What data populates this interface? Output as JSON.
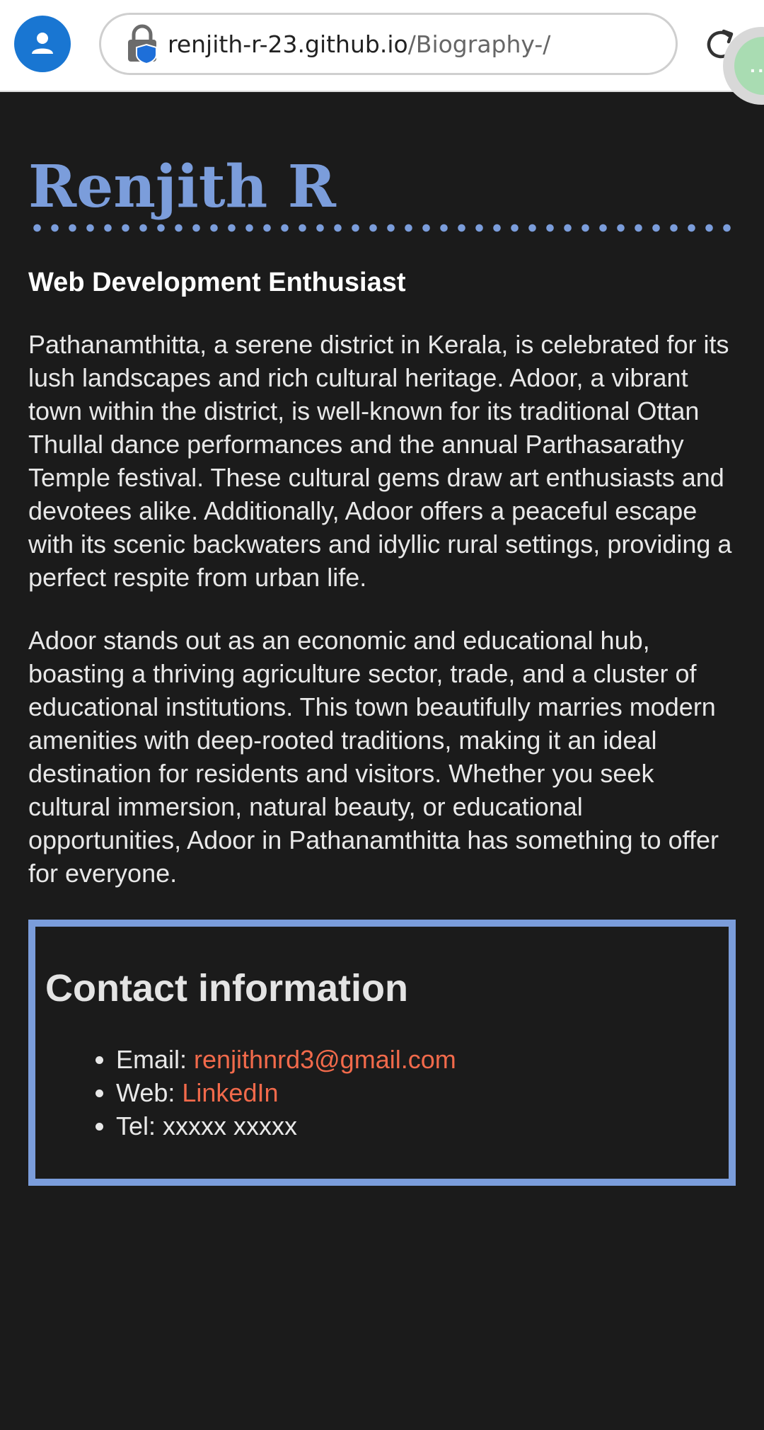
{
  "browser": {
    "url_domain": "renjith-r-23.github.io",
    "url_path": "/Biography-/",
    "profile_icon": "person-icon",
    "reload_icon": "reload-icon",
    "lock_icon": "lock-icon",
    "menu_icon": "ellipsis-icon"
  },
  "page": {
    "name": "Renjith R",
    "tagline": "Web Development Enthusiast",
    "paragraphs": [
      "Pathanamthitta, a serene district in Kerala, is celebrated for its lush landscapes and rich cultural heritage. Adoor, a vibrant town within the district, is well-known for its traditional Ottan Thullal dance performances and the annual Parthasarathy Temple festival. These cultural gems draw art enthusiasts and devotees alike. Additionally, Adoor offers a peaceful escape with its scenic backwaters and idyllic rural settings, providing a perfect respite from urban life.",
      "Adoor stands out as an economic and educational hub, boasting a thriving agriculture sector, trade, and a cluster of educational institutions. This town beautifully marries modern amenities with deep-rooted traditions, making it an ideal destination for residents and visitors. Whether you seek cultural immersion, natural beauty, or educational opportunities, Adoor in Pathanamthitta has something to offer for everyone."
    ]
  },
  "contact": {
    "title": "Contact information",
    "email_label": "Email: ",
    "email_value": "renjithnrd3@gmail.com",
    "web_label": "Web: ",
    "web_value": "LinkedIn",
    "tel_label": "Tel: ",
    "tel_value": "xxxxx xxxxx"
  },
  "colors": {
    "background": "#1b1b1b",
    "accent": "#7b9ddb",
    "link": "#f26a4b",
    "profile": "#1976d2"
  }
}
